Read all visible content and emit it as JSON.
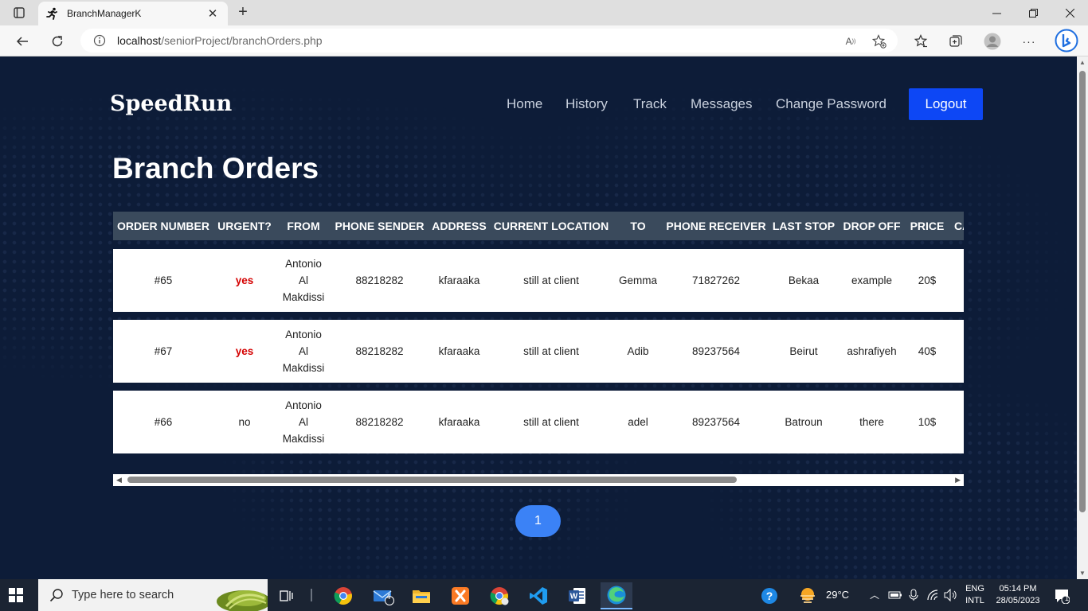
{
  "browser": {
    "tab_title": "BranchManagerK",
    "url_host": "localhost",
    "url_path": "/seniorProject/branchOrders.php"
  },
  "site": {
    "brand": "SpeedRun",
    "nav": [
      "Home",
      "History",
      "Track",
      "Messages",
      "Change Password"
    ],
    "logout_label": "Logout"
  },
  "page_title": "Branch Orders",
  "table": {
    "headers": [
      "ORDER NUMBER",
      "URGENT?",
      "FROM",
      "PHONE SENDER",
      "ADDRESS",
      "CURRENT LOCATION",
      "TO",
      "PHONE RECEIVER",
      "LAST STOP",
      "DROP OFF",
      "PRICE",
      "CA"
    ],
    "rows": [
      {
        "order": "#65",
        "urgent": "yes",
        "from_1": "Antonio",
        "from_2": "Al",
        "from_3": "Makdissi",
        "phone_sender": "88218282",
        "address": "kfaraaka",
        "current_location": "still at client",
        "to": "Gemma",
        "phone_receiver": "71827262",
        "last_stop": "Bekaa",
        "drop_off": "example",
        "price": "20$"
      },
      {
        "order": "#67",
        "urgent": "yes",
        "from_1": "Antonio",
        "from_2": "Al",
        "from_3": "Makdissi",
        "phone_sender": "88218282",
        "address": "kfaraaka",
        "current_location": "still at client",
        "to": "Adib",
        "phone_receiver": "89237564",
        "last_stop": "Beirut",
        "drop_off": "ashrafiyeh",
        "price": "40$"
      },
      {
        "order": "#66",
        "urgent": "no",
        "from_1": "Antonio",
        "from_2": "Al",
        "from_3": "Makdissi",
        "phone_sender": "88218282",
        "address": "kfaraaka",
        "current_location": "still at client",
        "to": "adel",
        "phone_receiver": "89237564",
        "last_stop": "Batroun",
        "drop_off": "there",
        "price": "10$"
      }
    ]
  },
  "pagination": {
    "current": "1"
  },
  "taskbar": {
    "search_placeholder": "Type here to search",
    "mail_badge": "4",
    "weather": "29°C",
    "lang_1": "ENG",
    "lang_2": "INTL",
    "time": "05:14 PM",
    "date": "28/05/2023",
    "notification_count": "1"
  },
  "colors": {
    "page_bg": "#0d1c38",
    "header_bg": "#3a4a5c",
    "logout_bg": "#0d47f5",
    "urgent_yes": "#d40000",
    "pager_bg": "#3b82f6"
  }
}
